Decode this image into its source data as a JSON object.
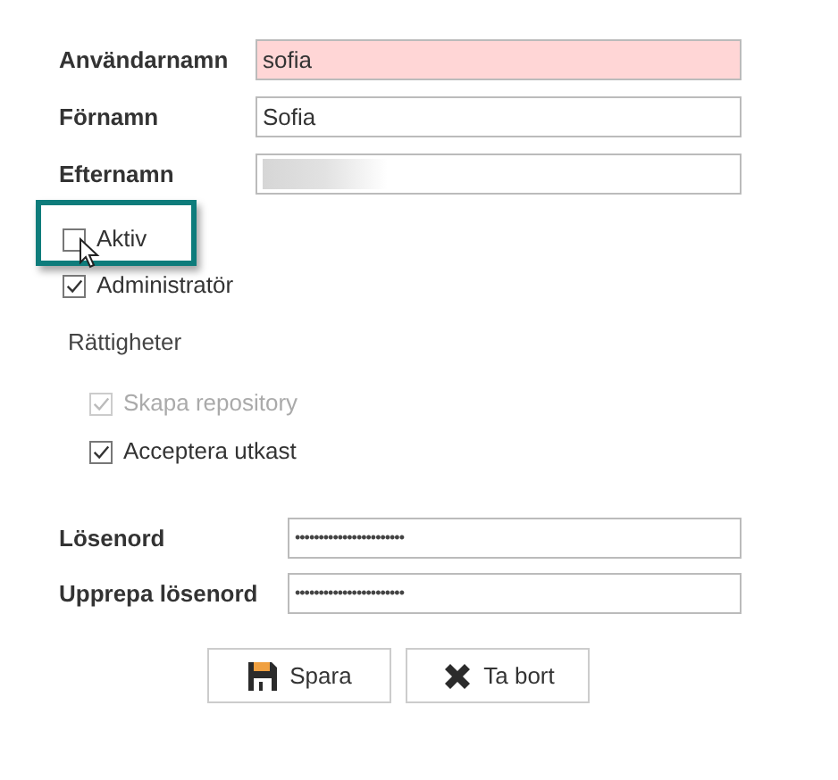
{
  "user_fields": [
    {
      "label": "Användarnamn",
      "value": "sofia",
      "error": true,
      "redacted": false
    },
    {
      "label": "Förnamn",
      "value": "Sofia",
      "error": false,
      "redacted": false
    },
    {
      "label": "Efternamn",
      "error": false,
      "redacted": true
    }
  ],
  "flags": [
    {
      "label": "Aktiv",
      "checked": false,
      "disabled": false,
      "highlighted": true
    },
    {
      "label": "Administratör",
      "checked": true,
      "disabled": false,
      "highlighted": false
    }
  ],
  "permissions": {
    "title": "Rättigheter",
    "items": [
      {
        "label": "Skapa repository",
        "checked": true,
        "disabled": true
      },
      {
        "label": "Acceptera utkast",
        "checked": true,
        "disabled": false
      }
    ]
  },
  "password_fields": [
    {
      "label": "Lösenord",
      "value": "•••••••••••••••••••••••"
    },
    {
      "label": "Upprepa lösenord",
      "value": "•••••••••••••••••••••••"
    }
  ],
  "buttons": [
    {
      "label": "Spara",
      "kind": "save"
    },
    {
      "label": "Ta bort",
      "kind": "delete"
    }
  ]
}
